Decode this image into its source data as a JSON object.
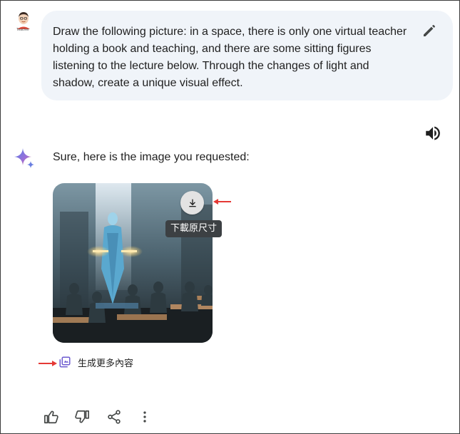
{
  "user": {
    "avatar_icon": "user-avatar-icon",
    "avatar_caption": "Teacher",
    "prompt": "Draw the following picture: in a space, there is only one virtual teacher holding a book and teaching, and there are some sitting figures listening to the lecture below. Through the changes of light and shadow, create a unique visual effect."
  },
  "response": {
    "text": "Sure, here is the image you requested:",
    "image_icon": "generated-image",
    "download_tooltip": "下載原尺寸",
    "generate_more_label": "生成更多內容"
  },
  "icons": {
    "edit": "pencil-icon",
    "speaker": "speaker-icon",
    "gemini": "sparkle-icon",
    "download": "download-icon",
    "thumbs_up": "thumbs-up-icon",
    "thumbs_down": "thumbs-down-icon",
    "share": "share-icon",
    "more": "more-vert-icon"
  },
  "colors": {
    "bubble": "#f0f4f9",
    "annotation_arrow": "#e53935",
    "tooltip_bg": "#3c4043"
  }
}
